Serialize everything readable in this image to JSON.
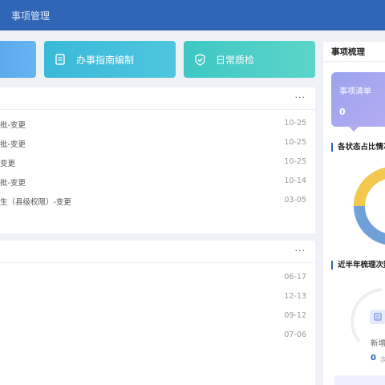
{
  "header": {
    "title": "事项管理"
  },
  "cards": [
    {
      "label": "",
      "icon": "card-icon"
    },
    {
      "label": "办事指南编制",
      "icon": "document-icon"
    },
    {
      "label": "日常质检",
      "icon": "shield-check-icon"
    }
  ],
  "panel1": {
    "more": "···",
    "rows": [
      {
        "title": "批-变更",
        "date": "10-25"
      },
      {
        "title": "批-变更",
        "date": "10-25"
      },
      {
        "title": "变更",
        "date": "10-25"
      },
      {
        "title": "批-变更",
        "date": "10-14"
      },
      {
        "title": "生（县级权限）-变更",
        "date": "03-05"
      }
    ]
  },
  "panel2": {
    "more": "···",
    "rows": [
      {
        "title": "",
        "date": "06-17"
      },
      {
        "title": "",
        "date": "12-13"
      },
      {
        "title": "",
        "date": "09-12"
      },
      {
        "title": "",
        "date": "07-06"
      }
    ]
  },
  "sidebar": {
    "title": "事项梳理",
    "stat_card": {
      "label": "事项清单",
      "value": "0"
    },
    "section_status": "各状态占比情况",
    "section_history": "近半年梳理次数",
    "new_label": "新增",
    "new_value": "0",
    "new_unit": "次"
  },
  "colors": {
    "topbar": "#2f66b6",
    "donut_yellow": "#f2c94c",
    "donut_blue": "#6fa0d8"
  }
}
